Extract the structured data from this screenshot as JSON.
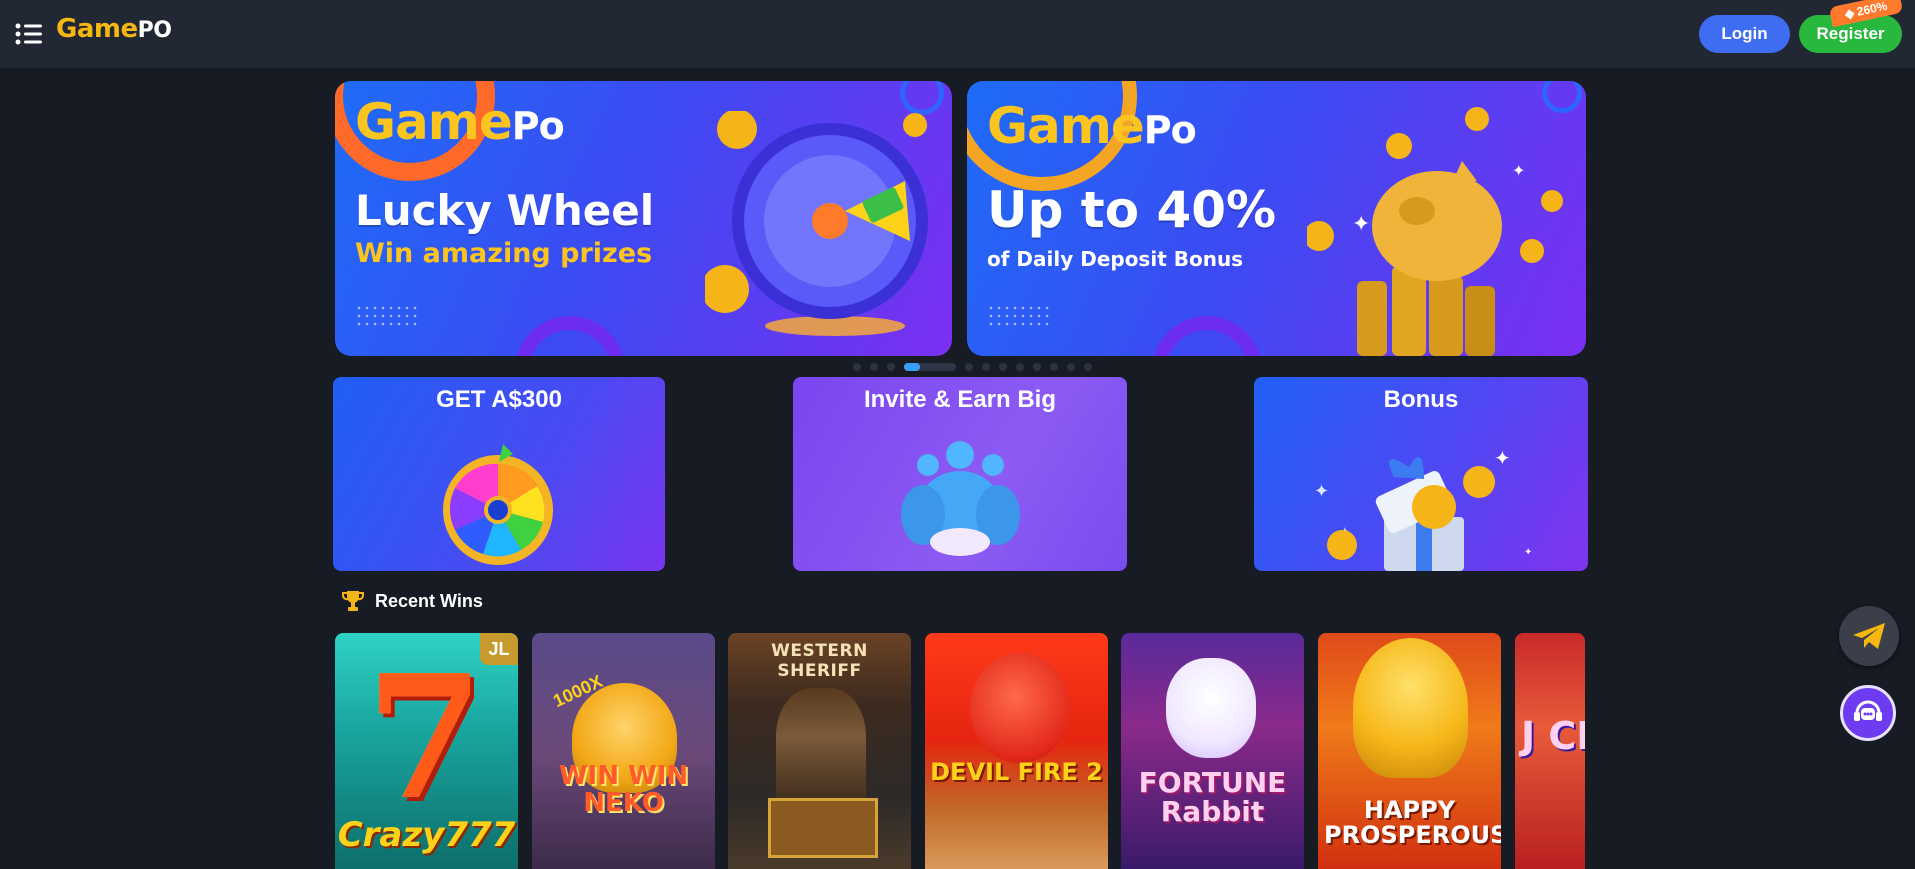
{
  "header": {
    "logo_part1": "Game",
    "logo_part2": "PO",
    "login_label": "Login",
    "register_label": "Register",
    "register_badge": "260%"
  },
  "banners": [
    {
      "logo_part1": "Game",
      "logo_part2": "Po",
      "headline": "Lucky Wheel",
      "subline": "Win amazing prizes"
    },
    {
      "logo_part1": "Game",
      "logo_part2": "Po",
      "headline": "Up to 40%",
      "subline": "of Daily Deposit Bonus"
    }
  ],
  "slider": {
    "dot_count": 12,
    "active_index": 3
  },
  "promos": [
    {
      "title": "GET A$300"
    },
    {
      "title": "Invite & Earn Big"
    },
    {
      "title": "Bonus"
    }
  ],
  "recent_wins": {
    "title": "Recent Wins",
    "games": [
      {
        "name": "Crazy777",
        "badge": "JL"
      },
      {
        "name": "WIN WIN NEKO",
        "badge": "1000X"
      },
      {
        "name": "WESTERN SHERIFF"
      },
      {
        "name": "DEVIL FIRE 2"
      },
      {
        "name": "FORTUNE Rabbit"
      },
      {
        "name": "HAPPY PROSPEROUS"
      },
      {
        "name": "J CR"
      }
    ]
  },
  "colors": {
    "accent_blue": "#3f6df1",
    "accent_green": "#27b83d",
    "brand_gold": "#f6b80f",
    "background": "#171b24"
  }
}
